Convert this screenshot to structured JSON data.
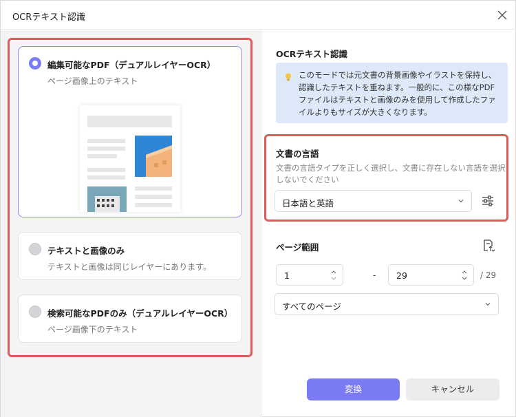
{
  "window": {
    "title": "OCRテキスト認識"
  },
  "options": [
    {
      "title": "編集可能なPDF（デュアルレイヤーOCR）",
      "subtitle": "ページ画像上のテキスト",
      "selected": true
    },
    {
      "title": "テキストと画像のみ",
      "subtitle": "テキストと画像は同じレイヤーにあります。",
      "selected": false
    },
    {
      "title": "検索可能なPDFのみ（デュアルレイヤーOCR）",
      "subtitle": "ページ画像下のテキスト",
      "selected": false
    }
  ],
  "info": {
    "heading": "OCRテキスト認識",
    "text": "このモードでは元文書の背景画像やイラストを保持し、認識したテキストを重ねます。一般的に、この様なPDFファイルはテキストと画像のみを使用して作成したファイルよりもサイズが大きくなります。"
  },
  "language": {
    "heading": "文書の言語",
    "description": "文書の言語タイプを正しく選択し、文書に存在しない言語を選択しないでください",
    "selected": "日本語と英語"
  },
  "page_range": {
    "heading": "ページ範囲",
    "from": "1",
    "separator": "-",
    "to": "29",
    "total": "/ 29",
    "scope": "すべてのページ"
  },
  "buttons": {
    "convert": "変換",
    "cancel": "キャンセル"
  },
  "colors": {
    "accent": "#7a7bf2",
    "highlight": "#e05a5a",
    "info_bg": "#dde9f9"
  }
}
